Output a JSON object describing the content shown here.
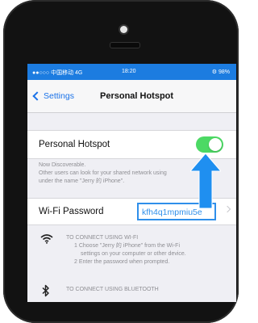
{
  "status_bar": {
    "carrier": "●●○○○ 中国移动  4G",
    "time": "18:20",
    "battery": "⚙ 98%"
  },
  "nav": {
    "back_label": "Settings",
    "title": "Personal Hotspot"
  },
  "hotspot": {
    "label": "Personal Hotspot",
    "toggle_on": true,
    "toggle_color": "#4cd964",
    "discoverable_text": "Now Discoverable.",
    "share_text_line1": "Other users can look for your shared network using",
    "share_text_line2": "under the name \"Jerry 的 iPhone\"."
  },
  "wifi_password": {
    "label": "Wi-Fi Password",
    "value": "kfh4q1mpmiu5e"
  },
  "instructions": {
    "wifi": {
      "icon": "wifi-icon",
      "title": "TO CONNECT USING WI-FI",
      "line1": "1 Choose \"Jerry 的 iPhone\" from the Wi-Fi",
      "line2": "settings on your computer or other device.",
      "line3": "2 Enter the password when prompted."
    },
    "bluetooth": {
      "icon": "bluetooth-icon",
      "title": "TO CONNECT USING BLUETOOTH"
    }
  },
  "accent_color": "#2f8fea",
  "annotation_arrow_color": "#1f8ff0"
}
